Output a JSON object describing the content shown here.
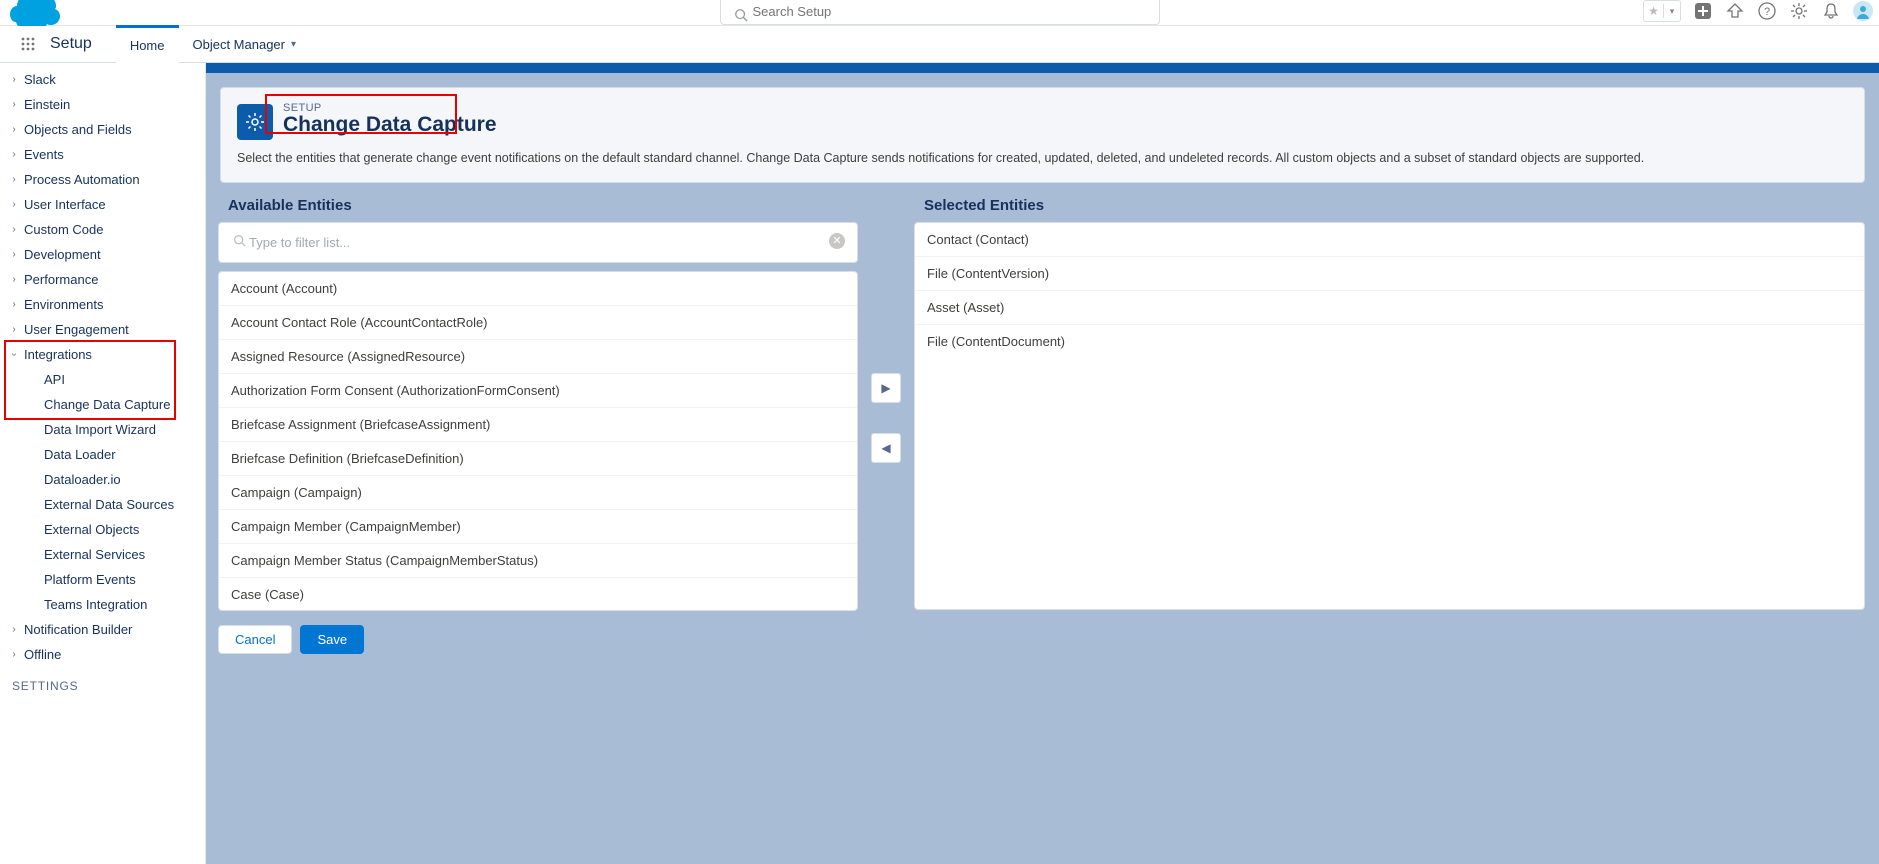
{
  "search": {
    "placeholder": "Search Setup"
  },
  "nav": {
    "setup_label": "Setup",
    "tabs": {
      "home": "Home",
      "object_manager": "Object Manager"
    }
  },
  "sidebar": {
    "items": [
      "Slack",
      "Einstein",
      "Objects and Fields",
      "Events",
      "Process Automation",
      "User Interface",
      "Custom Code",
      "Development",
      "Performance",
      "Environments",
      "User Engagement"
    ],
    "integrations_label": "Integrations",
    "integrations_children": [
      "API",
      "Change Data Capture",
      "Data Import Wizard",
      "Data Loader",
      "Dataloader.io",
      "External Data Sources",
      "External Objects",
      "External Services",
      "Platform Events",
      "Teams Integration"
    ],
    "after": [
      "Notification Builder",
      "Offline"
    ],
    "settings_heading": "SETTINGS"
  },
  "page": {
    "breadcrumb": "SETUP",
    "title": "Change Data Capture",
    "description": "Select the entities that generate change event notifications on the default standard channel. Change Data Capture sends notifications for created, updated, deleted, and undeleted records. All custom objects and a subset of standard objects are supported."
  },
  "lists": {
    "available_header": "Available Entities",
    "selected_header": "Selected Entities",
    "filter_placeholder": "Type to filter list...",
    "available": [
      "Account (Account)",
      "Account Contact Role (AccountContactRole)",
      "Assigned Resource (AssignedResource)",
      "Authorization Form Consent (AuthorizationFormConsent)",
      "Briefcase Assignment (BriefcaseAssignment)",
      "Briefcase Definition (BriefcaseDefinition)",
      "Campaign (Campaign)",
      "Campaign Member (CampaignMember)",
      "Campaign Member Status (CampaignMemberStatus)",
      "Case (Case)"
    ],
    "selected": [
      "Contact (Contact)",
      "File (ContentVersion)",
      "Asset (Asset)",
      "File (ContentDocument)"
    ]
  },
  "buttons": {
    "cancel": "Cancel",
    "save": "Save"
  }
}
